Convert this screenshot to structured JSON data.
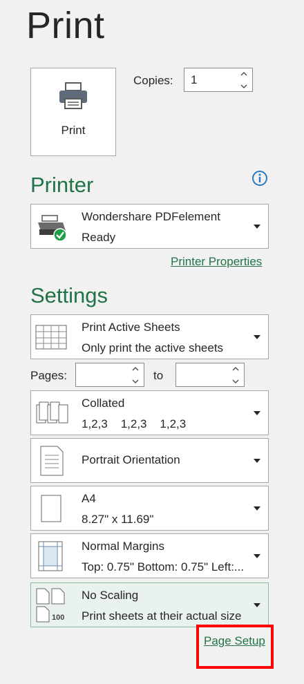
{
  "title": "Print",
  "print_button": {
    "label": "Print",
    "icon": "printer-icon"
  },
  "copies": {
    "label": "Copies:",
    "value": "1"
  },
  "printer": {
    "section_title": "Printer",
    "name": "Wondershare PDFelement",
    "status": "Ready",
    "properties_link": "Printer Properties"
  },
  "settings": {
    "section_title": "Settings",
    "active_sheets": {
      "title": "Print Active Sheets",
      "subtitle": "Only print the active sheets"
    },
    "pages": {
      "label": "Pages:",
      "from": "",
      "to_label": "to",
      "to": ""
    },
    "collation": {
      "title": "Collated",
      "subtitle": "1,2,3    1,2,3    1,2,3"
    },
    "orientation": {
      "title": "Portrait Orientation"
    },
    "paper": {
      "title": "A4",
      "subtitle": "8.27\" x 11.69\""
    },
    "margins": {
      "title": "Normal Margins",
      "subtitle": "Top: 0.75\" Bottom: 0.75\" Left:..."
    },
    "scaling": {
      "title": "No Scaling",
      "subtitle": "Print sheets at their actual size",
      "icon_text": "100"
    },
    "page_setup_link": "Page Setup"
  },
  "colors": {
    "accent": "#217346",
    "highlight": "#ff0000",
    "info": "#2b79c2"
  }
}
